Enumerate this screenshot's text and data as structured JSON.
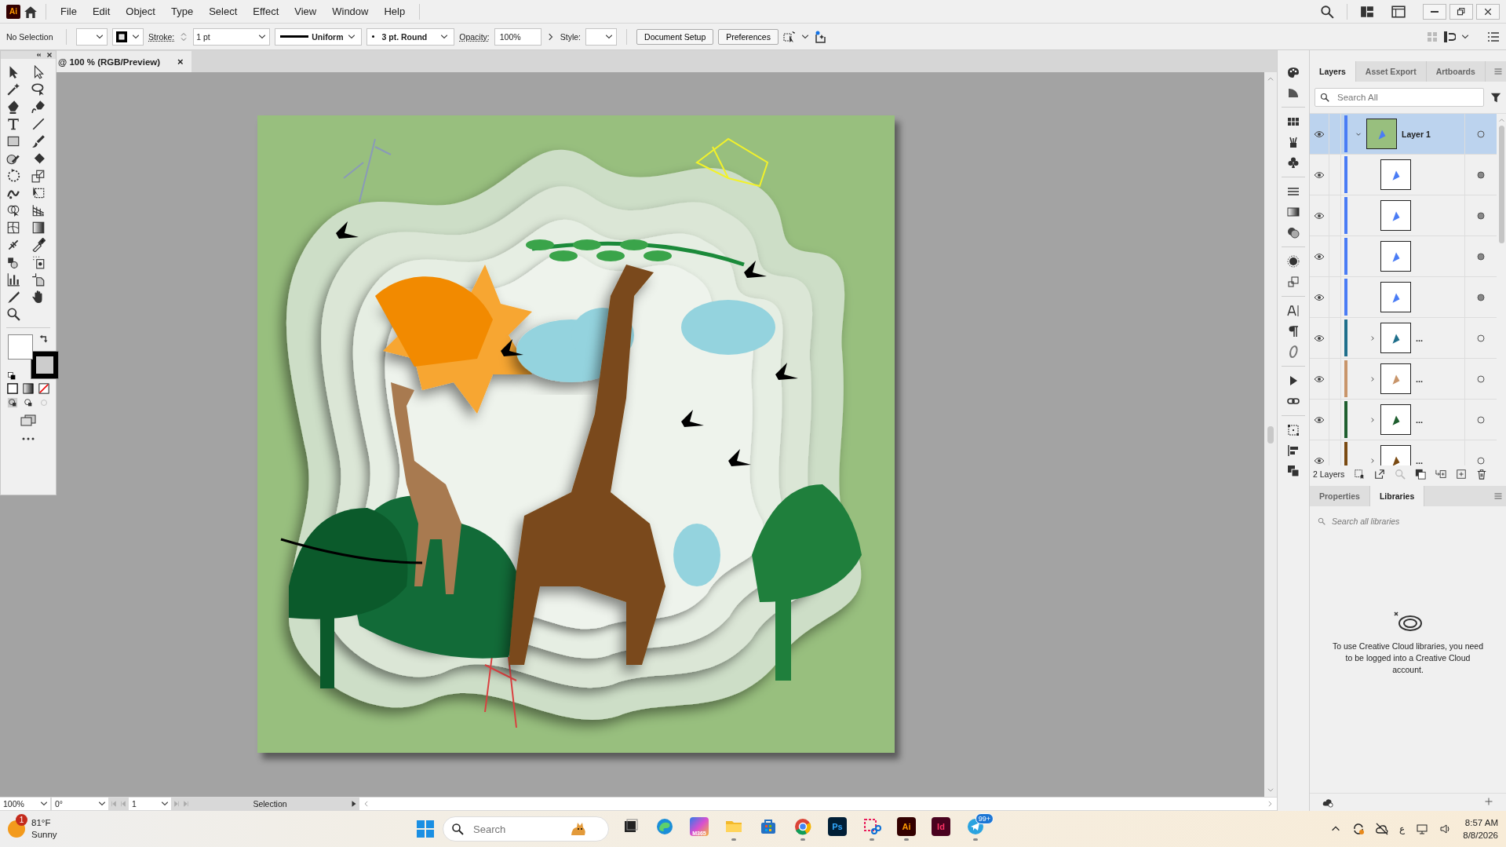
{
  "app": {
    "logo": "Ai",
    "menus": [
      "File",
      "Edit",
      "Object",
      "Type",
      "Select",
      "Effect",
      "View",
      "Window",
      "Help"
    ]
  },
  "control_bar": {
    "selection": "No Selection",
    "stroke_label": "Stroke:",
    "stroke_weight": "1 pt",
    "profile": "Uniform",
    "brush": "3 pt. Round",
    "opacity_label": "Opacity:",
    "opacity": "100%",
    "style_label": "Style:",
    "buttons": [
      "Document Setup",
      "Preferences"
    ]
  },
  "document_tab": {
    "title": "@ 100 % (RGB/Preview)",
    "close": "×"
  },
  "layers_panel": {
    "tabs": [
      {
        "label": "Layers",
        "selected": true
      },
      {
        "label": "Asset Export",
        "selected": false
      },
      {
        "label": "Artboards",
        "selected": false
      }
    ],
    "search": {
      "placeholder": "Search All"
    },
    "rows": [
      {
        "kind": "layer",
        "name": "Layer 1",
        "visible": true,
        "expanded": true,
        "selected": true,
        "color": "#4a7cf5",
        "appearance_filled": false
      },
      {
        "kind": "path",
        "visible": true,
        "selected": false,
        "color": "#4a7cf5",
        "appearance_filled": true
      },
      {
        "kind": "path",
        "visible": true,
        "selected": false,
        "color": "#4a7cf5",
        "appearance_filled": true
      },
      {
        "kind": "path",
        "visible": true,
        "selected": false,
        "color": "#4a7cf5",
        "appearance_filled": true
      },
      {
        "kind": "path",
        "visible": true,
        "selected": false,
        "color": "#4a7cf5",
        "appearance_filled": true
      },
      {
        "kind": "group",
        "more": "...",
        "visible": true,
        "expanded": false,
        "selected": false,
        "color": "#1f6f8b",
        "appearance_filled": false
      },
      {
        "kind": "group",
        "more": "...",
        "visible": true,
        "expanded": false,
        "selected": false,
        "color": "#c8956a",
        "appearance_filled": false
      },
      {
        "kind": "group",
        "more": "...",
        "visible": true,
        "expanded": false,
        "selected": false,
        "color": "#1e5e2e",
        "appearance_filled": false
      },
      {
        "kind": "group",
        "more": "...",
        "visible": true,
        "expanded": false,
        "selected": false,
        "color": "#7a4a12",
        "appearance_filled": false
      }
    ],
    "count": "2 Layers"
  },
  "libraries_panel": {
    "tabs": [
      {
        "label": "Properties",
        "selected": false
      },
      {
        "label": "Libraries",
        "selected": true
      }
    ],
    "search": {
      "placeholder": "Search all libraries"
    },
    "message": "To use Creative Cloud libraries, you need to be logged into a Creative Cloud account."
  },
  "status_bar": {
    "zoom": "100%",
    "rotation": "0°",
    "artboard": "1",
    "tool": "Selection"
  },
  "taskbar": {
    "weather": {
      "badge": "1",
      "temp": "81°F",
      "condition": "Sunny"
    },
    "search": {
      "placeholder": "Search"
    },
    "apps": [
      {
        "kind": "taskview",
        "running": false
      },
      {
        "kind": "edge",
        "running": false
      },
      {
        "kind": "m365",
        "label": "M365",
        "running": false
      },
      {
        "kind": "explorer",
        "running": true
      },
      {
        "kind": "store",
        "running": false
      },
      {
        "kind": "chrome",
        "running": true
      },
      {
        "kind": "photoshop",
        "label": "Ps",
        "running": false
      },
      {
        "kind": "snipping",
        "running": true
      },
      {
        "kind": "illustrator",
        "label": "Ai",
        "running": true
      },
      {
        "kind": "indesign",
        "label": "Id",
        "running": false
      },
      {
        "kind": "telegram",
        "badge": "99+",
        "running": true
      }
    ],
    "language": "ع",
    "time": "8:57 AM",
    "date": "8/8/2026"
  }
}
